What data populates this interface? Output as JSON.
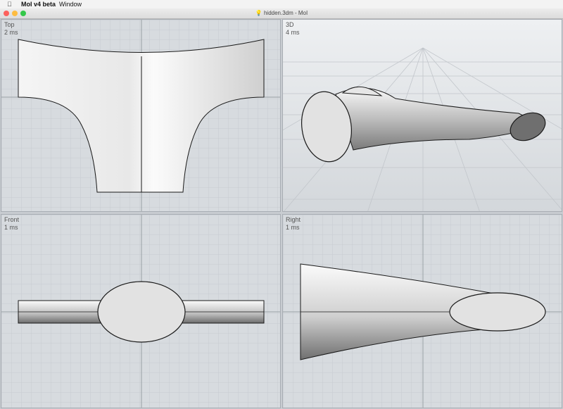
{
  "menubar": {
    "apple_icon": "apple-logo-icon",
    "app_name": "MoI v4 beta",
    "window_menu": "Window"
  },
  "window": {
    "title": "hidden.3dm - MoI",
    "title_icon": "lightbulb-icon"
  },
  "viewports": [
    {
      "name": "Top",
      "time": "2 ms"
    },
    {
      "name": "3D",
      "time": "4 ms"
    },
    {
      "name": "Front",
      "time": "1 ms"
    },
    {
      "name": "Right",
      "time": "1 ms"
    }
  ],
  "colors": {
    "viewport_bg": "#d7dbdf",
    "grid": "#c7cbd0",
    "axis": "#9aa0a6",
    "surface": "#f2f2f2",
    "edge": "#1a1a1a"
  }
}
